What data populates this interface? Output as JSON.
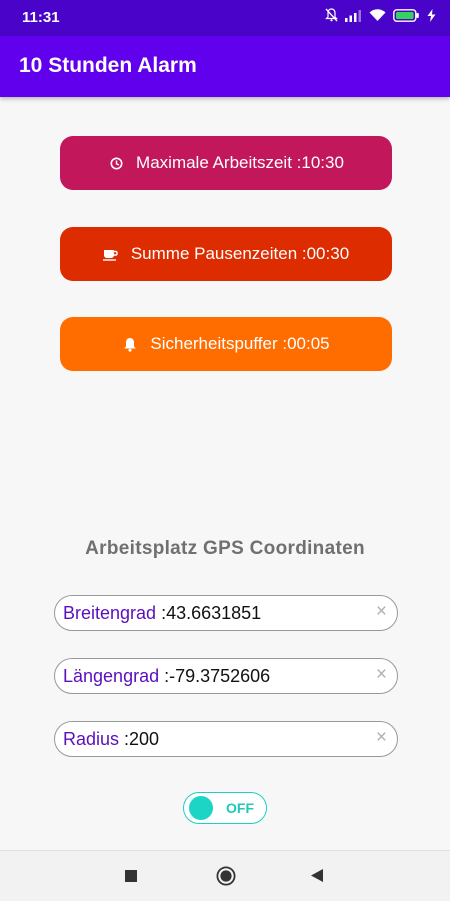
{
  "status_bar": {
    "time": "11:31",
    "icons": [
      "mute-bell-icon",
      "signal-icon",
      "wifi-icon",
      "battery-icon",
      "charging-icon"
    ]
  },
  "app_bar": {
    "title": "10 Stunden Alarm",
    "color": "#6100ed"
  },
  "buttons": {
    "arbeitszeit": {
      "label": "Maximale Arbeitszeit :10:30",
      "icon": "clock-icon",
      "color": "#c2185b"
    },
    "pausen": {
      "label": "Summe Pausenzeiten :00:30",
      "icon": "coffee-cup-icon",
      "color": "#dd2c00"
    },
    "puffer": {
      "label": "Sicherheitspuffer :00:05",
      "icon": "bell-icon",
      "color": "#ff6d00"
    }
  },
  "gps": {
    "heading": "Arbeitsplatz GPS Coordinaten",
    "fields": {
      "breitengrad": {
        "label": "Breitengrad",
        "value": " :43.6631851"
      },
      "laengengrad": {
        "label": "Längengrad",
        "value": " :-79.3752606"
      },
      "radius": {
        "label": "Radius",
        "value": " :200"
      }
    },
    "clear_glyph": "×"
  },
  "toggle": {
    "label": "OFF",
    "state": "off",
    "color": "#1cd5c5"
  },
  "nav_bar": {
    "buttons": [
      "recents-icon",
      "home-icon",
      "back-icon"
    ]
  }
}
